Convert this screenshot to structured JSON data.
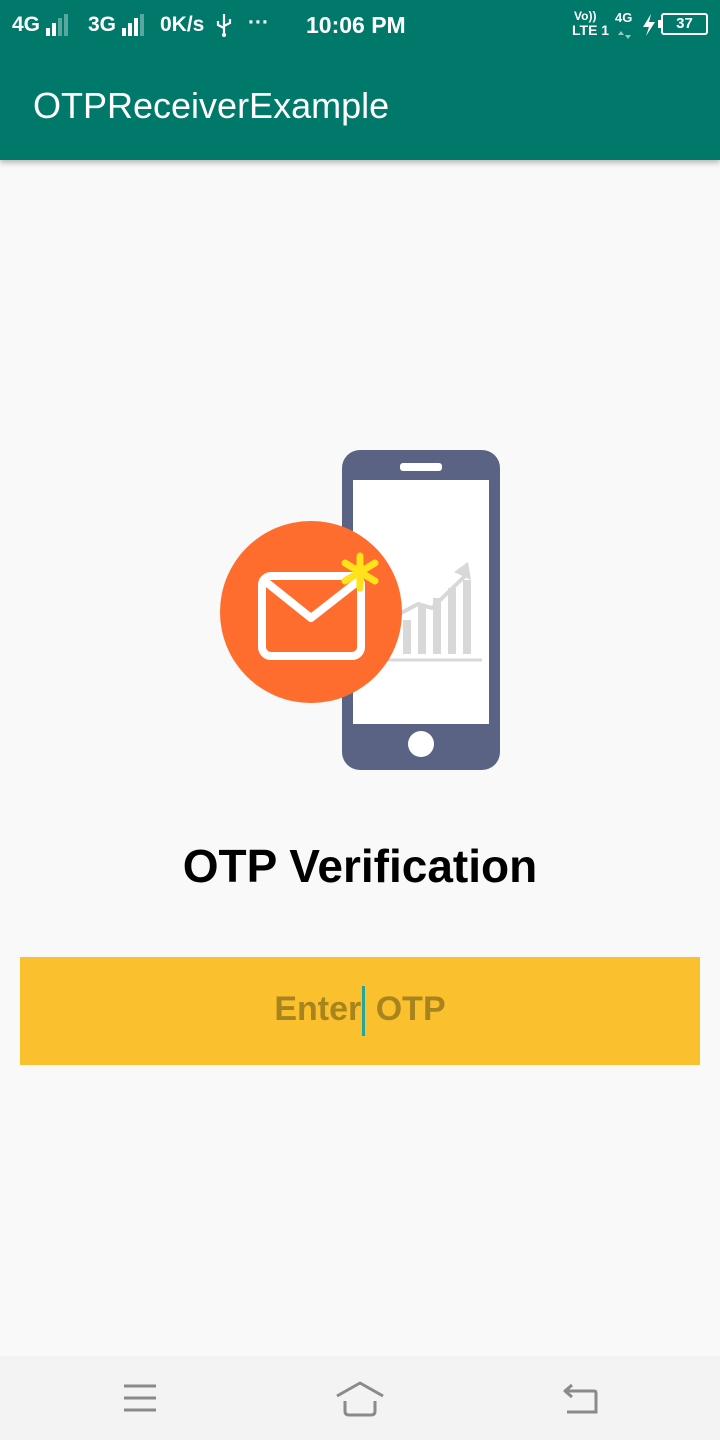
{
  "status_bar": {
    "net1": "4G",
    "net2": "3G",
    "speed": "0K/s",
    "more": "···",
    "time": "10:06 PM",
    "volte_top": "Vo))",
    "volte_bottom": "LTE 1",
    "net3": "4G",
    "battery": "37"
  },
  "app_bar": {
    "title": "OTPReceiverExample"
  },
  "main": {
    "heading": "OTP Verification",
    "otp_placeholder_start": "Enter",
    "otp_placeholder_end": " OTP"
  },
  "icons": {
    "illustration": "phone-with-envelope-icon",
    "menu": "menu-icon",
    "home": "home-icon",
    "back": "back-icon"
  },
  "colors": {
    "primary": "#00796b",
    "field": "#fbc02d",
    "accent_circle": "#ff6d2e",
    "phone": "#5a6384"
  }
}
